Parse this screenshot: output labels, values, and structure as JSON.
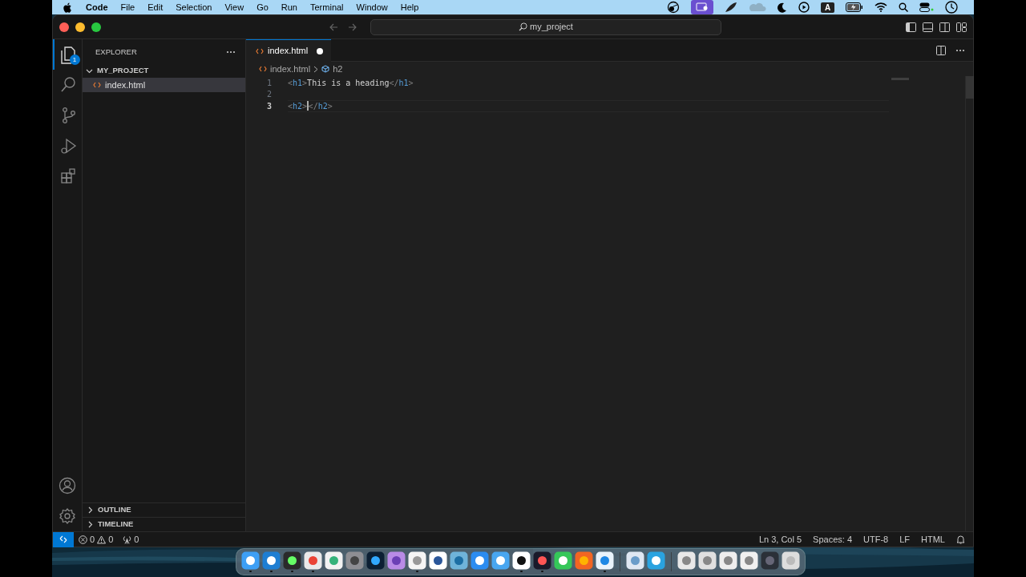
{
  "menu_bar": {
    "app": "Code",
    "items": [
      "File",
      "Edit",
      "Selection",
      "View",
      "Go",
      "Run",
      "Terminal",
      "Window",
      "Help"
    ],
    "input_source": "A"
  },
  "window": {
    "search": "my_project"
  },
  "activity_bar": {
    "items": [
      {
        "kind": "files",
        "selected": true,
        "badge": "1"
      },
      {
        "kind": "search",
        "selected": false
      },
      {
        "kind": "source-control",
        "selected": false
      },
      {
        "kind": "run",
        "selected": false
      },
      {
        "kind": "extensions",
        "selected": false
      }
    ]
  },
  "sidebar": {
    "title": "EXPLORER",
    "folder": {
      "name": "MY_PROJECT",
      "expanded": true,
      "children": [
        {
          "name": "index.html",
          "selected": true
        }
      ]
    },
    "sections": [
      {
        "name": "OUTLINE",
        "expanded": false
      },
      {
        "name": "TIMELINE",
        "expanded": false
      }
    ]
  },
  "tabs": [
    {
      "label": "index.html",
      "selected": true,
      "modified": true
    }
  ],
  "breadcrumb": [
    "index.html",
    "h2"
  ],
  "editor": {
    "lines": [
      {
        "number": "1",
        "current": false,
        "tokens": [
          {
            "kind": "punct",
            "text": "<"
          },
          {
            "kind": "tag",
            "text": "h1"
          },
          {
            "kind": "punct",
            "text": ">"
          },
          {
            "kind": "text",
            "text": "This is a heading"
          },
          {
            "kind": "punct",
            "text": "</"
          },
          {
            "kind": "tag",
            "text": "h1"
          },
          {
            "kind": "punct",
            "text": ">"
          }
        ]
      },
      {
        "number": "2",
        "current": false
      },
      {
        "number": "3",
        "current": true,
        "tokens": [
          {
            "kind": "punct",
            "text": "<"
          },
          {
            "kind": "tag",
            "text": "h2"
          },
          {
            "kind": "punct",
            "text": ">"
          },
          {
            "kind": "cursor"
          },
          {
            "kind": "punct",
            "text": "</"
          },
          {
            "kind": "tag",
            "text": "h2"
          },
          {
            "kind": "punct",
            "text": ">"
          }
        ]
      }
    ]
  },
  "status_bar": {
    "errors": "0",
    "warnings": "0",
    "ports": "0",
    "right": [
      "Ln 3, Col 5",
      "Spaces: 4",
      "UTF-8",
      "LF",
      "HTML"
    ]
  },
  "dock": {
    "groups": [
      [
        {
          "running": true
        },
        {
          "running": true
        },
        {
          "running": true
        },
        {
          "running": true
        },
        {
          "running": false
        },
        {
          "running": false
        },
        {
          "running": false
        },
        {
          "running": false
        },
        {
          "running": true
        },
        {
          "running": false
        },
        {
          "running": false
        },
        {
          "running": false
        },
        {
          "running": false
        },
        {
          "running": true
        },
        {
          "running": true
        },
        {
          "running": false
        },
        {
          "running": false
        },
        {
          "running": true
        }
      ],
      [
        {
          "running": false
        },
        {
          "running": false
        }
      ],
      [
        {
          "running": false
        },
        {
          "running": false
        },
        {
          "running": false
        },
        {
          "running": false
        },
        {
          "running": false
        },
        {
          "running": false
        }
      ]
    ]
  }
}
